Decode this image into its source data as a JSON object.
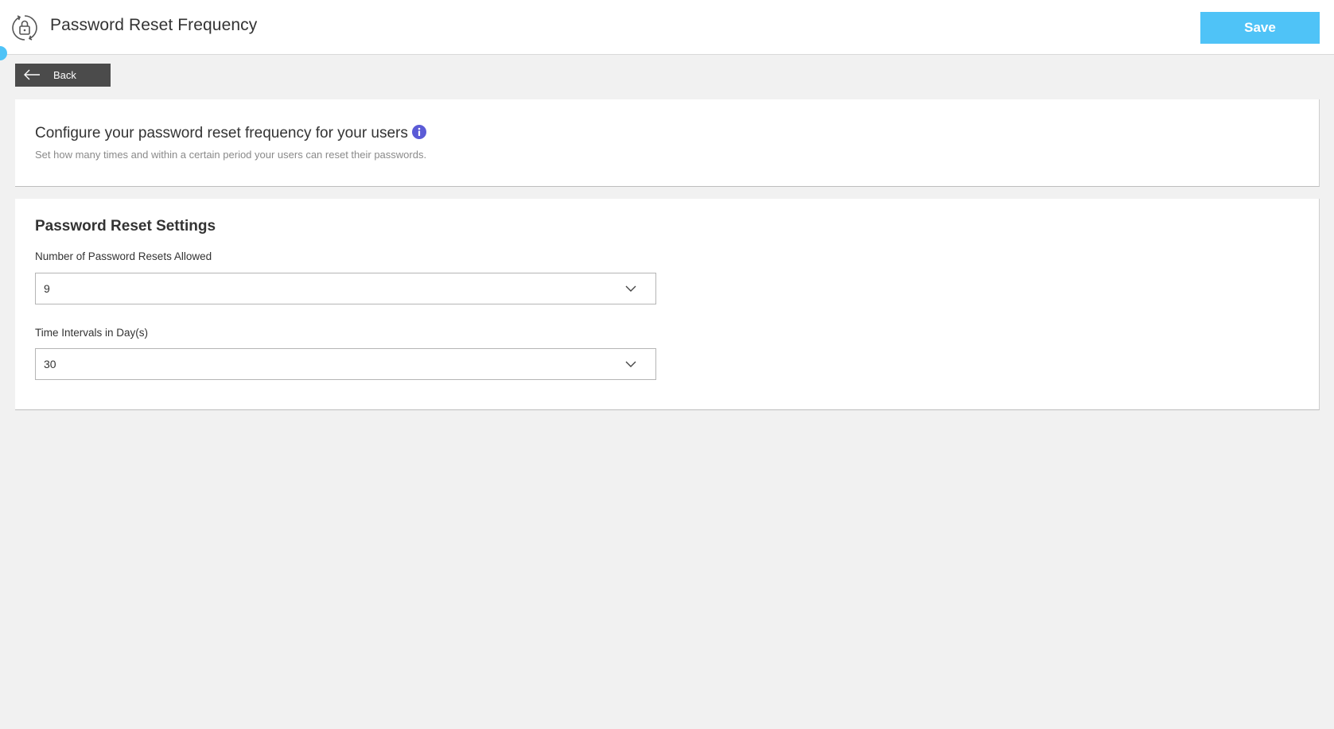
{
  "header": {
    "title": "Password Reset Frequency",
    "icon": "lock-reset-icon",
    "save_label": "Save",
    "accent_color": "#4fc3f7"
  },
  "back": {
    "label": "Back",
    "icon": "arrow-left-icon"
  },
  "intro": {
    "title": "Configure your password reset frequency for your users",
    "subtitle": "Set how many times and within a certain period your users can reset their passwords.",
    "info_icon": "info-icon",
    "info_color": "#5b5bd6"
  },
  "settings": {
    "title": "Password Reset Settings",
    "resets_label": "Number of Password Resets Allowed",
    "resets_value": "9",
    "interval_label": "Time Intervals in Day(s)",
    "interval_value": "30"
  }
}
